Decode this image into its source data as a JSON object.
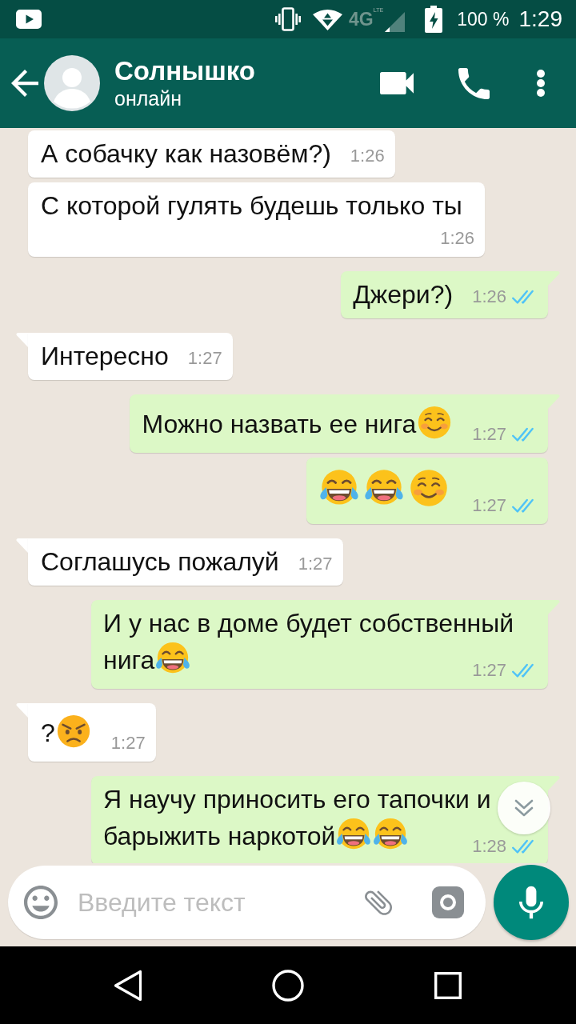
{
  "status_bar": {
    "network": "4G",
    "network_sub": "LTE",
    "battery": "100 %",
    "time": "1:29"
  },
  "header": {
    "title": "Солнышко",
    "subtitle": "онлайн"
  },
  "messages": [
    {
      "kind": "incoming",
      "tail": false,
      "lines": [
        "А собачку как назовём?)"
      ],
      "time": "1:26"
    },
    {
      "kind": "incoming",
      "tail": false,
      "lines": [
        "С которой гулять будешь только ты"
      ],
      "time": "1:26"
    },
    {
      "kind": "outgoing",
      "tail": true,
      "lines": [
        "Джери?)"
      ],
      "time": "1:26",
      "read": true
    },
    {
      "kind": "incoming",
      "tail": true,
      "lines": [
        "Интересно"
      ],
      "time": "1:27"
    },
    {
      "kind": "outgoing",
      "tail": true,
      "lines": [
        "Можно назвать ее нига"
      ],
      "emojis": [
        {
          "kind": "smiling"
        }
      ],
      "time": "1:27",
      "read": true
    },
    {
      "kind": "outgoing",
      "tail": false,
      "emojis": [
        {
          "kind": "tears-of-joy"
        },
        {
          "kind": "tears-of-joy"
        },
        {
          "kind": "smiling"
        }
      ],
      "time": "1:27",
      "read": true
    },
    {
      "kind": "incoming",
      "tail": true,
      "lines": [
        "Соглашусь пожалуй"
      ],
      "time": "1:27"
    },
    {
      "kind": "outgoing",
      "tail": true,
      "lines": [
        "И у нас в доме будет собственный",
        "нига"
      ],
      "emojis": [
        {
          "kind": "tears-of-joy"
        }
      ],
      "time": "1:27",
      "read": true
    },
    {
      "kind": "incoming",
      "tail": true,
      "lines": [
        "?"
      ],
      "emojis": [
        {
          "kind": "angry"
        }
      ],
      "time": "1:27"
    },
    {
      "kind": "outgoing",
      "tail": true,
      "lines": [
        "Я научу приносить его тапочки и",
        "барыжить наркотой"
      ],
      "emojis": [
        {
          "kind": "tears-of-joy"
        },
        {
          "kind": "tears-of-joy"
        }
      ],
      "time": "1:28",
      "read": true
    }
  ],
  "composer": {
    "placeholder": "Введите текст"
  }
}
